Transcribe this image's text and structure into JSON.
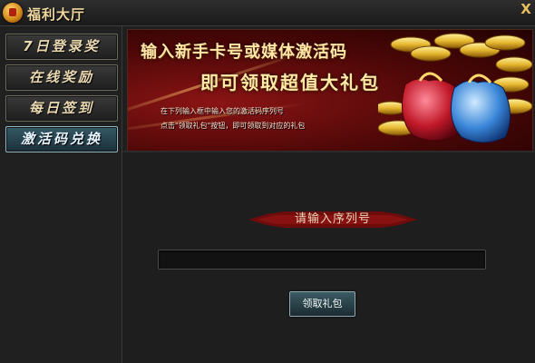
{
  "window": {
    "title": "福利大厅",
    "close_glyph": "X"
  },
  "sidebar": {
    "items": [
      {
        "label": "7日登录奖",
        "active": false
      },
      {
        "label": "在线奖励",
        "active": false
      },
      {
        "label": "每日签到",
        "active": false
      },
      {
        "label": "激活码兑换",
        "active": true
      }
    ]
  },
  "banner": {
    "line1": "输入新手卡号或媒体激活码",
    "line2": "即可领取超值大礼包",
    "instruction1": "在下列输入框中输入您的激活码序列号",
    "instruction2": "点击\"领取礼包\"按钮，即可领取到对应的礼包"
  },
  "form": {
    "ribbon_label": "请输入序列号",
    "serial_value": "",
    "claim_button": "领取礼包"
  },
  "colors": {
    "accent_gold": "#ffe7a8",
    "active_tab": "#365a66",
    "ribbon_red": "#7a0e0e"
  }
}
